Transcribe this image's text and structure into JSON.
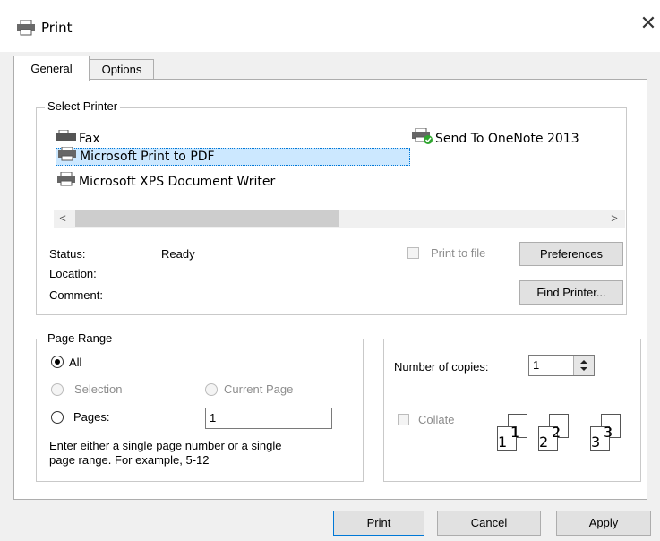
{
  "window": {
    "title": "Print",
    "close_symbol": "✕"
  },
  "tabs": [
    {
      "label": "General"
    },
    {
      "label": "Options"
    }
  ],
  "select_printer": {
    "label": "Select Printer",
    "printers": [
      {
        "name": "Fax"
      },
      {
        "name": "Microsoft Print to PDF",
        "selected": true
      },
      {
        "name": "Microsoft XPS Document Writer"
      },
      {
        "name": "Send To OneNote 2013"
      }
    ],
    "scroll_left": "<",
    "scroll_right": ">",
    "status_label": "Status:",
    "status_value": "Ready",
    "location_label": "Location:",
    "comment_label": "Comment:",
    "print_to_file_label": "Print to file",
    "preferences_label": "Preferences",
    "find_printer_label": "Find Printer..."
  },
  "page_range": {
    "label": "Page Range",
    "all_label": "All",
    "selection_label": "Selection",
    "current_page_label": "Current Page",
    "pages_label": "Pages:",
    "pages_value": "1",
    "hint_line1": "Enter either a single page number or a single",
    "hint_line2": "page range.  For example, 5-12"
  },
  "copies": {
    "number_label": "Number of copies:",
    "number_value": "1",
    "collate_label": "Collate",
    "collate_pages": [
      "1",
      "1",
      "2",
      "2",
      "3",
      "3"
    ]
  },
  "footer": {
    "print_label": "Print",
    "cancel_label": "Cancel",
    "apply_label": "Apply"
  }
}
